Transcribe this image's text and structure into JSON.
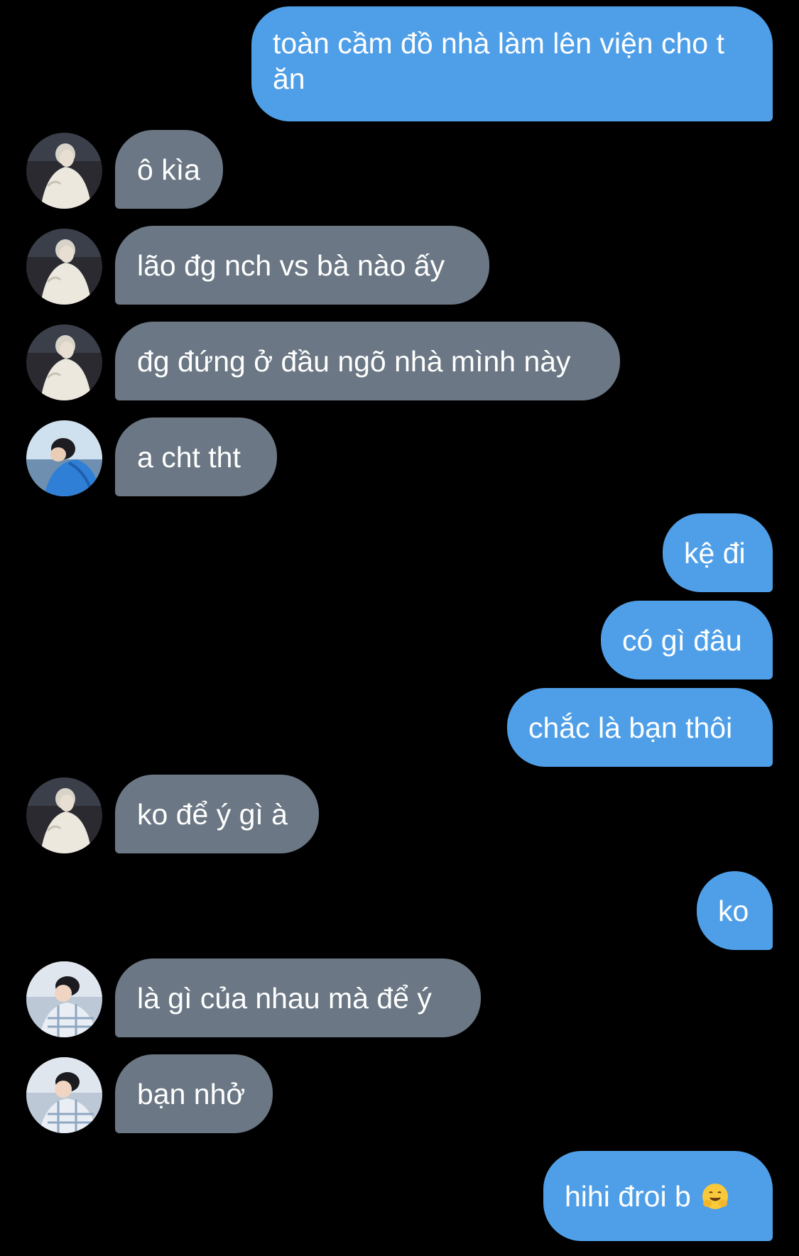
{
  "conversation": {
    "messages": [
      {
        "side": "sent",
        "text": "toàn cầm đồ nhà làm lên viện cho t ăn"
      },
      {
        "side": "received",
        "avatar": "avatar-white-coat",
        "text": "ô kìa"
      },
      {
        "side": "received",
        "avatar": "avatar-white-coat",
        "text": "lão đg nch vs bà nào ấy"
      },
      {
        "side": "received",
        "avatar": "avatar-white-coat",
        "text": "đg đứng ở đầu ngõ nhà mình này"
      },
      {
        "side": "received",
        "avatar": "avatar-blue-jacket",
        "text": "a cht tht"
      },
      {
        "side": "sent",
        "text": "kệ đi"
      },
      {
        "side": "sent",
        "text": "có gì đâu"
      },
      {
        "side": "sent",
        "text": "chắc là bạn thôi"
      },
      {
        "side": "received",
        "avatar": "avatar-white-coat",
        "text": "ko để ý gì à"
      },
      {
        "side": "sent",
        "text": "ko"
      },
      {
        "side": "received",
        "avatar": "avatar-plaid-shirt",
        "text": "là gì của nhau mà để ý"
      },
      {
        "side": "received",
        "avatar": "avatar-plaid-shirt",
        "text": "bạn nhở"
      },
      {
        "side": "sent",
        "text": "hihi đroi b",
        "emoji": "hugging-face-emoji"
      }
    ]
  },
  "colors": {
    "background": "#000000",
    "sent_bubble": "#4f9fe8",
    "received_bubble": "#6b7784",
    "text": "#ffffff"
  }
}
